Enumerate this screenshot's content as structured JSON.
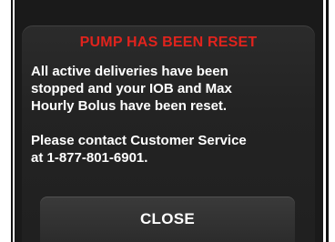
{
  "dialog": {
    "title": "PUMP HAS BEEN RESET",
    "message_lines": [
      "All active deliveries have been",
      "stopped and your IOB and Max",
      "Hourly Bolus have been reset."
    ],
    "contact_lines": [
      "Please contact Customer Service",
      "at 1-877-801-6901."
    ],
    "close_label": "CLOSE"
  },
  "colors": {
    "title": "#e0231d",
    "background": "#1a1a1a",
    "text": "#ffffff"
  }
}
